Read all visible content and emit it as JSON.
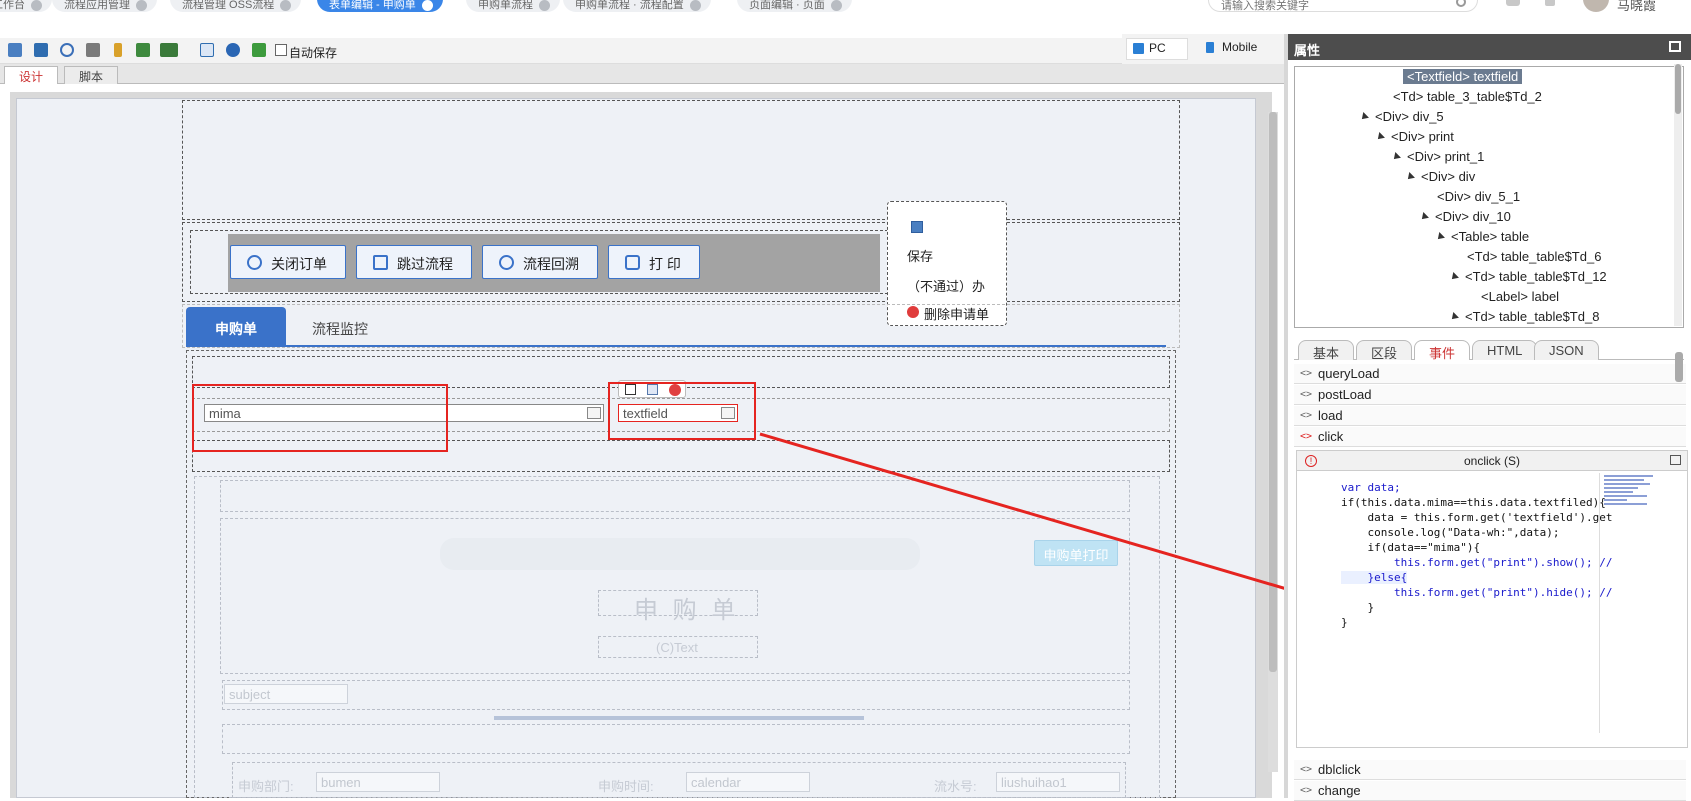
{
  "top_tabs": [
    {
      "label": "工作台"
    },
    {
      "label": "流程应用管理"
    },
    {
      "label": "流程管理 OSS流程"
    },
    {
      "label": "表单编辑 - 申购单",
      "active": true
    },
    {
      "label": "申购单流程"
    },
    {
      "label": "申购单流程 · 流程配置"
    },
    {
      "label": "页面编辑 · 页面"
    }
  ],
  "top_search": {
    "placeholder": "请输入搜索关键字"
  },
  "user": {
    "name": "马晓霞"
  },
  "toolbar": {
    "autosave_label": "自动保存",
    "mode_pc": "PC",
    "mode_mobile": "Mobile"
  },
  "design_tabs": [
    {
      "label": "设计",
      "active": true
    },
    {
      "label": "脚本"
    }
  ],
  "action_buttons": [
    {
      "label": "关闭订单"
    },
    {
      "label": "跳过流程"
    },
    {
      "label": "流程回溯"
    },
    {
      "label": "打 印"
    }
  ],
  "popup_menu": {
    "save_label": "保存",
    "middle_label": "（不通过）办",
    "delete_label": "删除申请单"
  },
  "form_tabs": [
    {
      "label": "申购单",
      "active": true
    },
    {
      "label": "流程监控"
    }
  ],
  "fields": {
    "mima_value": "mima",
    "textfield_value": "textfield"
  },
  "form_body": {
    "print_button": "申购单打印",
    "title": "申 购 单",
    "text_label": "(C)Text",
    "subject_placeholder": "subject",
    "dept_label": "申购部门:",
    "dept_value": "bumen",
    "time_label": "申购时间:",
    "time_value": "calendar",
    "serial_label": "流水号:",
    "serial_value": "liushuihao1"
  },
  "properties_panel": {
    "title": "属性",
    "tree": [
      {
        "label": "<Textfield> textfield",
        "indent": 0,
        "selected": true
      },
      {
        "label": "<Td> table_3_table$Td_2",
        "indent": 0
      },
      {
        "label": "<Div> div_5",
        "indent": 1
      },
      {
        "label": "<Div> print",
        "indent": 2
      },
      {
        "label": "<Div> print_1",
        "indent": 3
      },
      {
        "label": "<Div> div",
        "indent": 4
      },
      {
        "label": "<Div> div_5_1",
        "indent": 5
      },
      {
        "label": "<Div> div_10",
        "indent": 6
      },
      {
        "label": "<Table> table",
        "indent": 7
      },
      {
        "label": "<Td> table_table$Td_6",
        "indent": 8
      },
      {
        "label": "<Td> table_table$Td_12",
        "indent": 9
      },
      {
        "label": "<Label> label",
        "indent": 10
      },
      {
        "label": "<Td> table_table$Td_8",
        "indent": 11
      }
    ],
    "tabs": [
      {
        "label": "基本"
      },
      {
        "label": "区段"
      },
      {
        "label": "事件",
        "active": true
      },
      {
        "label": "HTML"
      },
      {
        "label": "JSON"
      }
    ],
    "events_top": [
      "queryLoad",
      "postLoad",
      "load",
      "click"
    ],
    "events_bottom": [
      "dblclick",
      "change"
    ],
    "code_title": "onclick (S)",
    "code_lines": [
      "var data;",
      "if(this.data.mima==this.data.textfiled){",
      "    data = this.form.get('textfield').get",
      "    console.log(\"Data-wh:\",data);",
      "    if(data==\"mima\"){",
      "        this.form.get(\"print\").show(); //",
      "    }else{",
      "        this.form.get(\"print\").hide(); //",
      "    }",
      "}"
    ]
  },
  "colors": {
    "accent": "#3a72c9",
    "annotation_red": "#e52420",
    "panel_header": "#4d4d4d"
  }
}
